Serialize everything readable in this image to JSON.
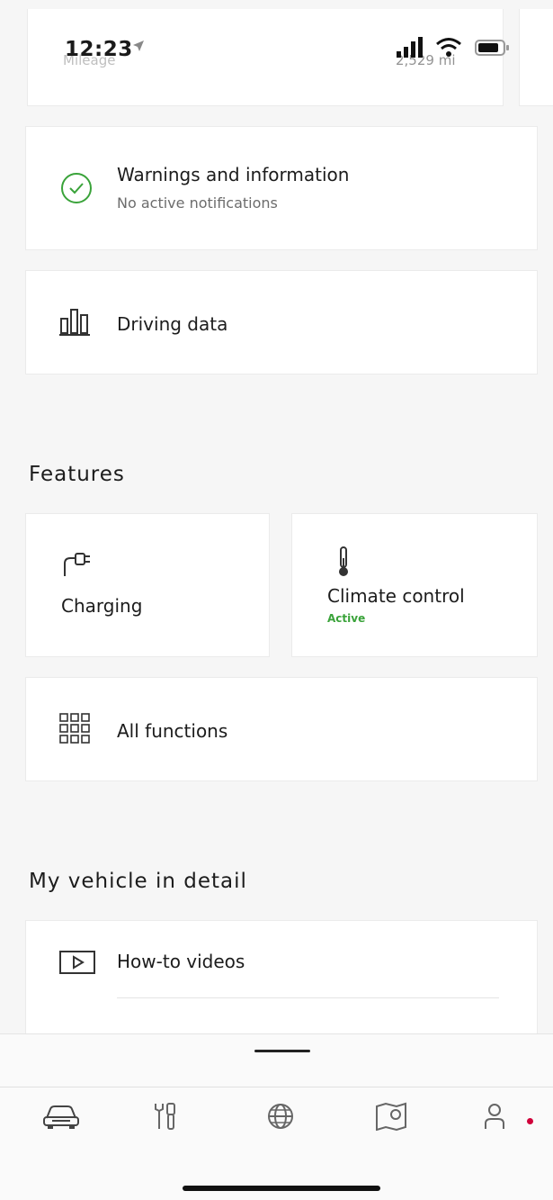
{
  "status_bar": {
    "time": "12:23"
  },
  "mileage": {
    "label": "Mileage",
    "value": "2,529 mi"
  },
  "warnings": {
    "title": "Warnings and information",
    "subtitle": "No active notifications"
  },
  "driving_data": {
    "label": "Driving data"
  },
  "features": {
    "heading": "Features",
    "charging": {
      "label": "Charging"
    },
    "climate": {
      "label": "Climate control",
      "status": "Active"
    },
    "all_functions": {
      "label": "All functions"
    }
  },
  "vehicle_detail": {
    "heading": "My vehicle in detail",
    "items": [
      {
        "label": "How-to videos"
      }
    ]
  },
  "bottom_nav": {
    "items": [
      {
        "icon": "car-icon"
      },
      {
        "icon": "tools-icon"
      },
      {
        "icon": "globe-icon"
      },
      {
        "icon": "map-icon"
      },
      {
        "icon": "user-icon"
      }
    ]
  },
  "colors": {
    "accent_green": "#3aa33a",
    "notification_dot": "#d0003a"
  }
}
